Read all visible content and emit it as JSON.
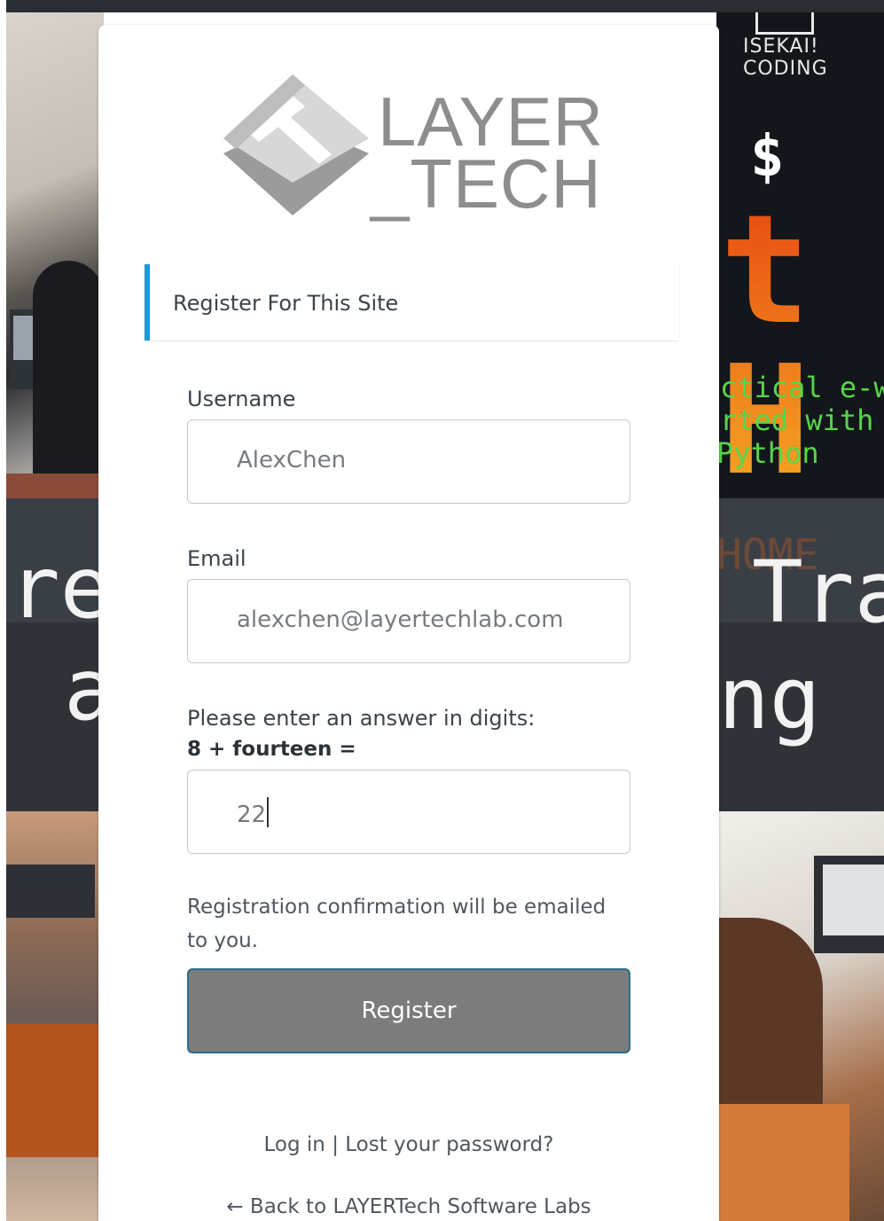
{
  "background": {
    "code_panel": {
      "title": "ISEKAI! CODING",
      "big_text": "t H",
      "line1": "ctical e-w",
      "line2": "rted with ",
      "line3": "Python"
    },
    "banner": {
      "left_top": "re",
      "left_bottom": "a",
      "right_top": "Tra",
      "right_bottom": "ng",
      "faded": "HOME"
    }
  },
  "logo": {
    "line1": "LAYER",
    "line2": "_TECH"
  },
  "notice": {
    "text": "Register For This Site"
  },
  "form": {
    "username": {
      "label": "Username",
      "value": "AlexChen"
    },
    "email": {
      "label": "Email",
      "value": "alexchen@layertechlab.com"
    },
    "captcha": {
      "label": "Please enter an answer in digits:",
      "question": "8 + fourteen =",
      "value": "22"
    },
    "info": "Registration confirmation will be emailed to you.",
    "submit_label": "Register"
  },
  "nav": {
    "login": "Log in",
    "separator": "|",
    "lost_password": "Lost your password?",
    "back": "← Back to LAYERTech Software Labs"
  },
  "colors": {
    "accent": "#1a9ad6",
    "button_bg": "#7c7c7c",
    "button_border": "#2b6c8d",
    "text": "#3c434a"
  }
}
